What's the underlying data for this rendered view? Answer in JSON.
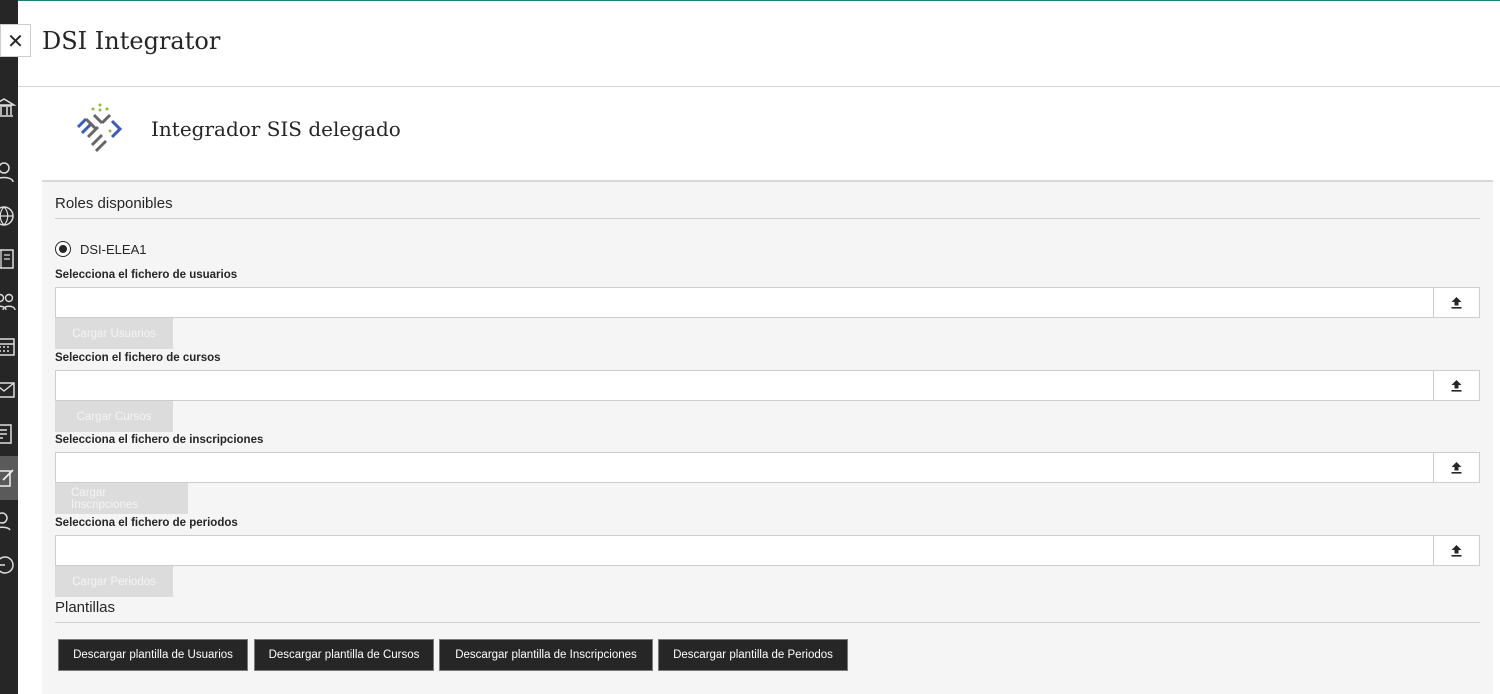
{
  "nav": {
    "icons": [
      "institution-icon",
      "user-icon",
      "globe-icon",
      "courses-icon",
      "groups-icon",
      "calendar-icon",
      "messages-icon",
      "grades-icon",
      "tools-icon",
      "profile-icon",
      "logout-icon"
    ]
  },
  "header": {
    "close_symbol": "✕",
    "title": "DSI Integrator"
  },
  "tool": {
    "title": "Integrador SIS delegado"
  },
  "roles": {
    "section_title": "Roles disponibles",
    "selected_role": "DSI-ELEA1"
  },
  "uploads": [
    {
      "label": "Selecciona el fichero de usuarios",
      "value": "",
      "button": "Cargar Usuarios"
    },
    {
      "label": "Seleccion el fichero de cursos",
      "value": "",
      "button": "Cargar Cursos"
    },
    {
      "label": "Selecciona el fichero de inscripciones",
      "value": "",
      "button": "Cargar Inscripciones"
    },
    {
      "label": "Selecciona el fichero de periodos",
      "value": "",
      "button": "Cargar Periodos"
    }
  ],
  "templates": {
    "section_title": "Plantillas",
    "buttons": [
      "Descargar plantilla de Usuarios",
      "Descargar plantilla de Cursos",
      "Descargar plantilla de Inscripciones",
      "Descargar plantilla de Periodos"
    ]
  },
  "colors": {
    "accent": "#1b7f7a",
    "dark_button": "#262626",
    "disabled_button": "#dcdcdc",
    "panel_bg": "#f5f5f5",
    "logo_blue": "#3b5bb5",
    "logo_gray": "#666666",
    "logo_green": "#8cbf3f"
  }
}
